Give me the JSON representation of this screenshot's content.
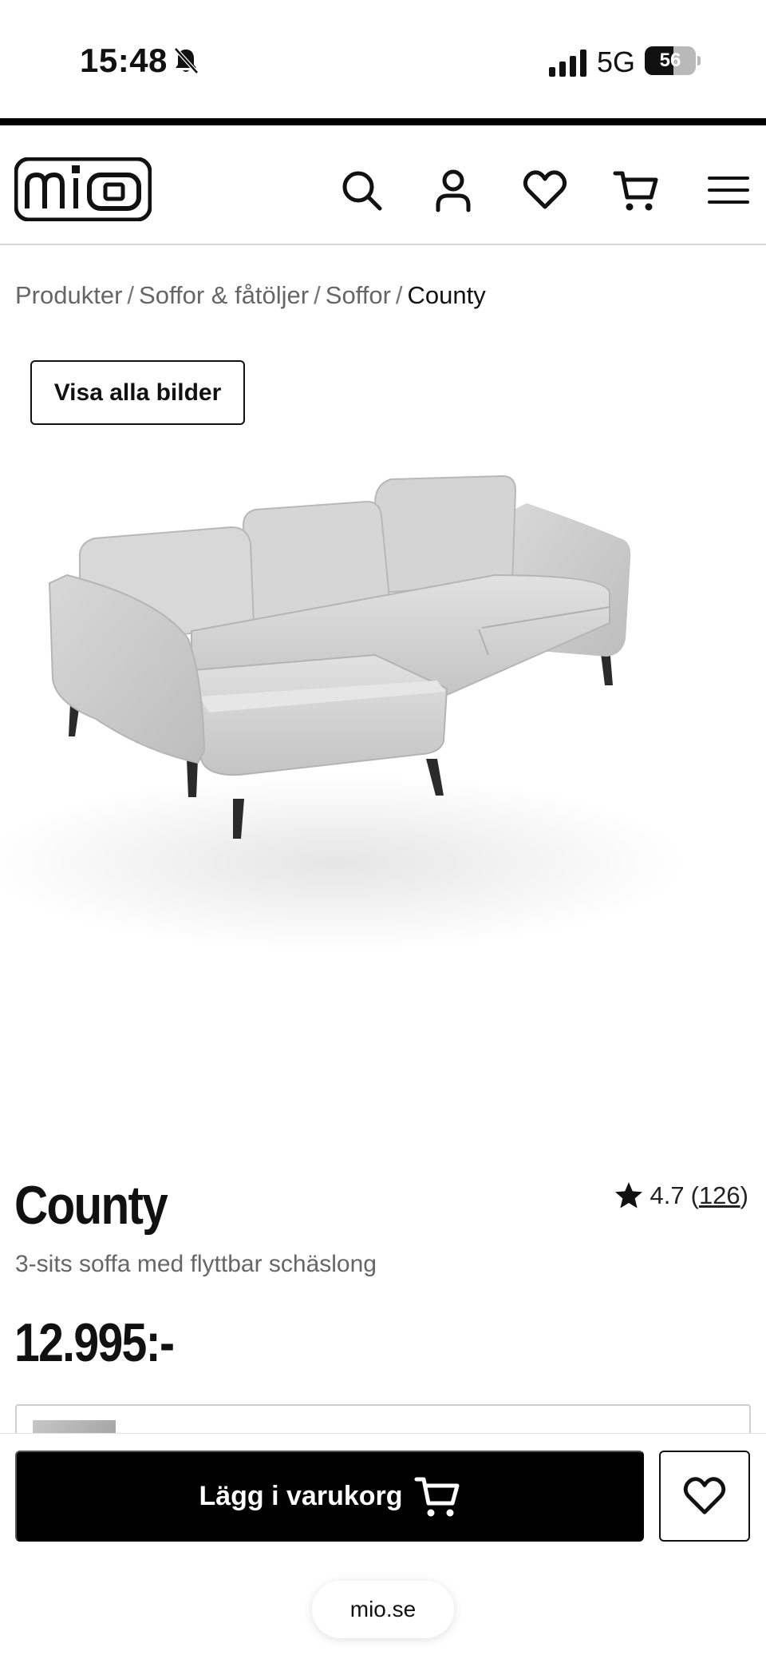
{
  "status_bar": {
    "time": "15:48",
    "network": "5G",
    "battery": "56",
    "battery_level": 0.56
  },
  "header": {
    "logo_text": "mio",
    "icons": [
      "search-icon",
      "user-icon",
      "heart-icon",
      "cart-icon",
      "menu-icon"
    ]
  },
  "breadcrumb": {
    "items": [
      "Produkter",
      "Soffor & fåtöljer",
      "Soffor"
    ],
    "current": "County",
    "separator": "/"
  },
  "gallery": {
    "show_all_label": "Visa alla bilder"
  },
  "product": {
    "title": "County",
    "rating": "4.7",
    "review_count": "126",
    "rating_open": "(",
    "rating_close": ")",
    "subtitle": "3-sits soffa med flyttbar schäslong",
    "price": "12.995:-"
  },
  "actions": {
    "add_to_cart_label": "Lägg i varukorg"
  },
  "browser": {
    "url": "mio.se"
  },
  "colors": {
    "accent": "#000000",
    "muted_text": "#666666",
    "divider": "#d6d6d6"
  }
}
